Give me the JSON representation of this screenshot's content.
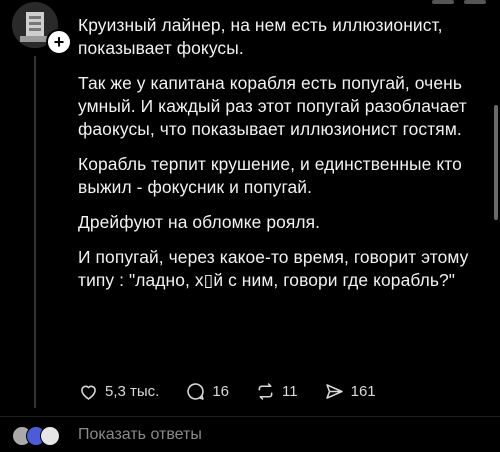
{
  "post": {
    "paragraphs": [
      "Круизный лайнер, на нем есть иллюзионист, показывает фокусы.",
      "Так же у капитана корабля есть попугай, очень умный. И каждый раз этот попугай разоблачает фаокусы, что показывает иллюзионист гостям.",
      "Корабль терпит крушение, и единственные кто выжил - фокусник и попугай.",
      "Дрейфуют на обломке рояля.",
      "И попугай, через какое-то время, говорит этому типу : \"ладно, х▯й с ним, говори где корабль?\""
    ]
  },
  "actions": {
    "likes": "5,3 тыс.",
    "comments": "16",
    "reposts": "11",
    "shares": "161"
  },
  "replies": {
    "label": "Показать ответы"
  },
  "icons": {
    "avatar": "profile-avatar",
    "follow": "plus-icon",
    "like": "heart-icon",
    "comment": "comment-bubble-icon",
    "repost": "repost-icon",
    "share": "send-icon"
  },
  "colors": {
    "background": "#000000",
    "text": "#f2f2f2",
    "muted": "#8a8a8a"
  }
}
